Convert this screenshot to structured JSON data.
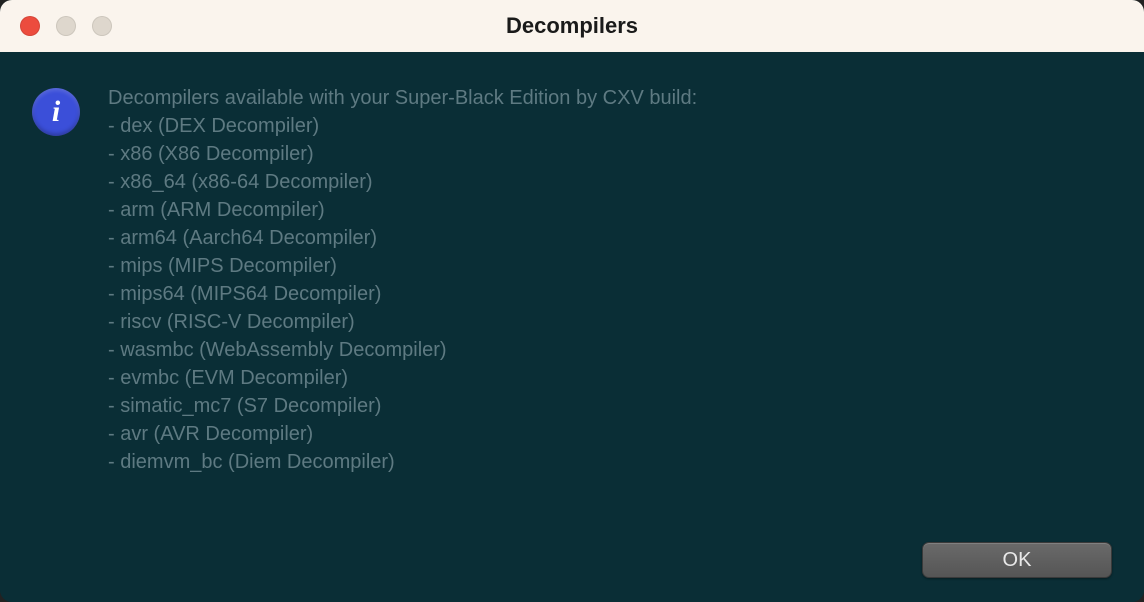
{
  "window": {
    "title": "Decompilers"
  },
  "dialog": {
    "icon": "info-icon",
    "heading": "Decompilers available with your Super-Black Edition by CXV build:",
    "items": [
      "- dex (DEX Decompiler)",
      "- x86 (X86 Decompiler)",
      "- x86_64 (x86-64 Decompiler)",
      "- arm (ARM Decompiler)",
      "- arm64 (Aarch64 Decompiler)",
      "- mips (MIPS Decompiler)",
      "- mips64 (MIPS64 Decompiler)",
      "- riscv (RISC-V Decompiler)",
      "- wasmbc (WebAssembly Decompiler)",
      "- evmbc (EVM Decompiler)",
      "- simatic_mc7 (S7 Decompiler)",
      "- avr (AVR Decompiler)",
      "- diemvm_bc (Diem Decompiler)"
    ]
  },
  "buttons": {
    "ok": "OK"
  }
}
